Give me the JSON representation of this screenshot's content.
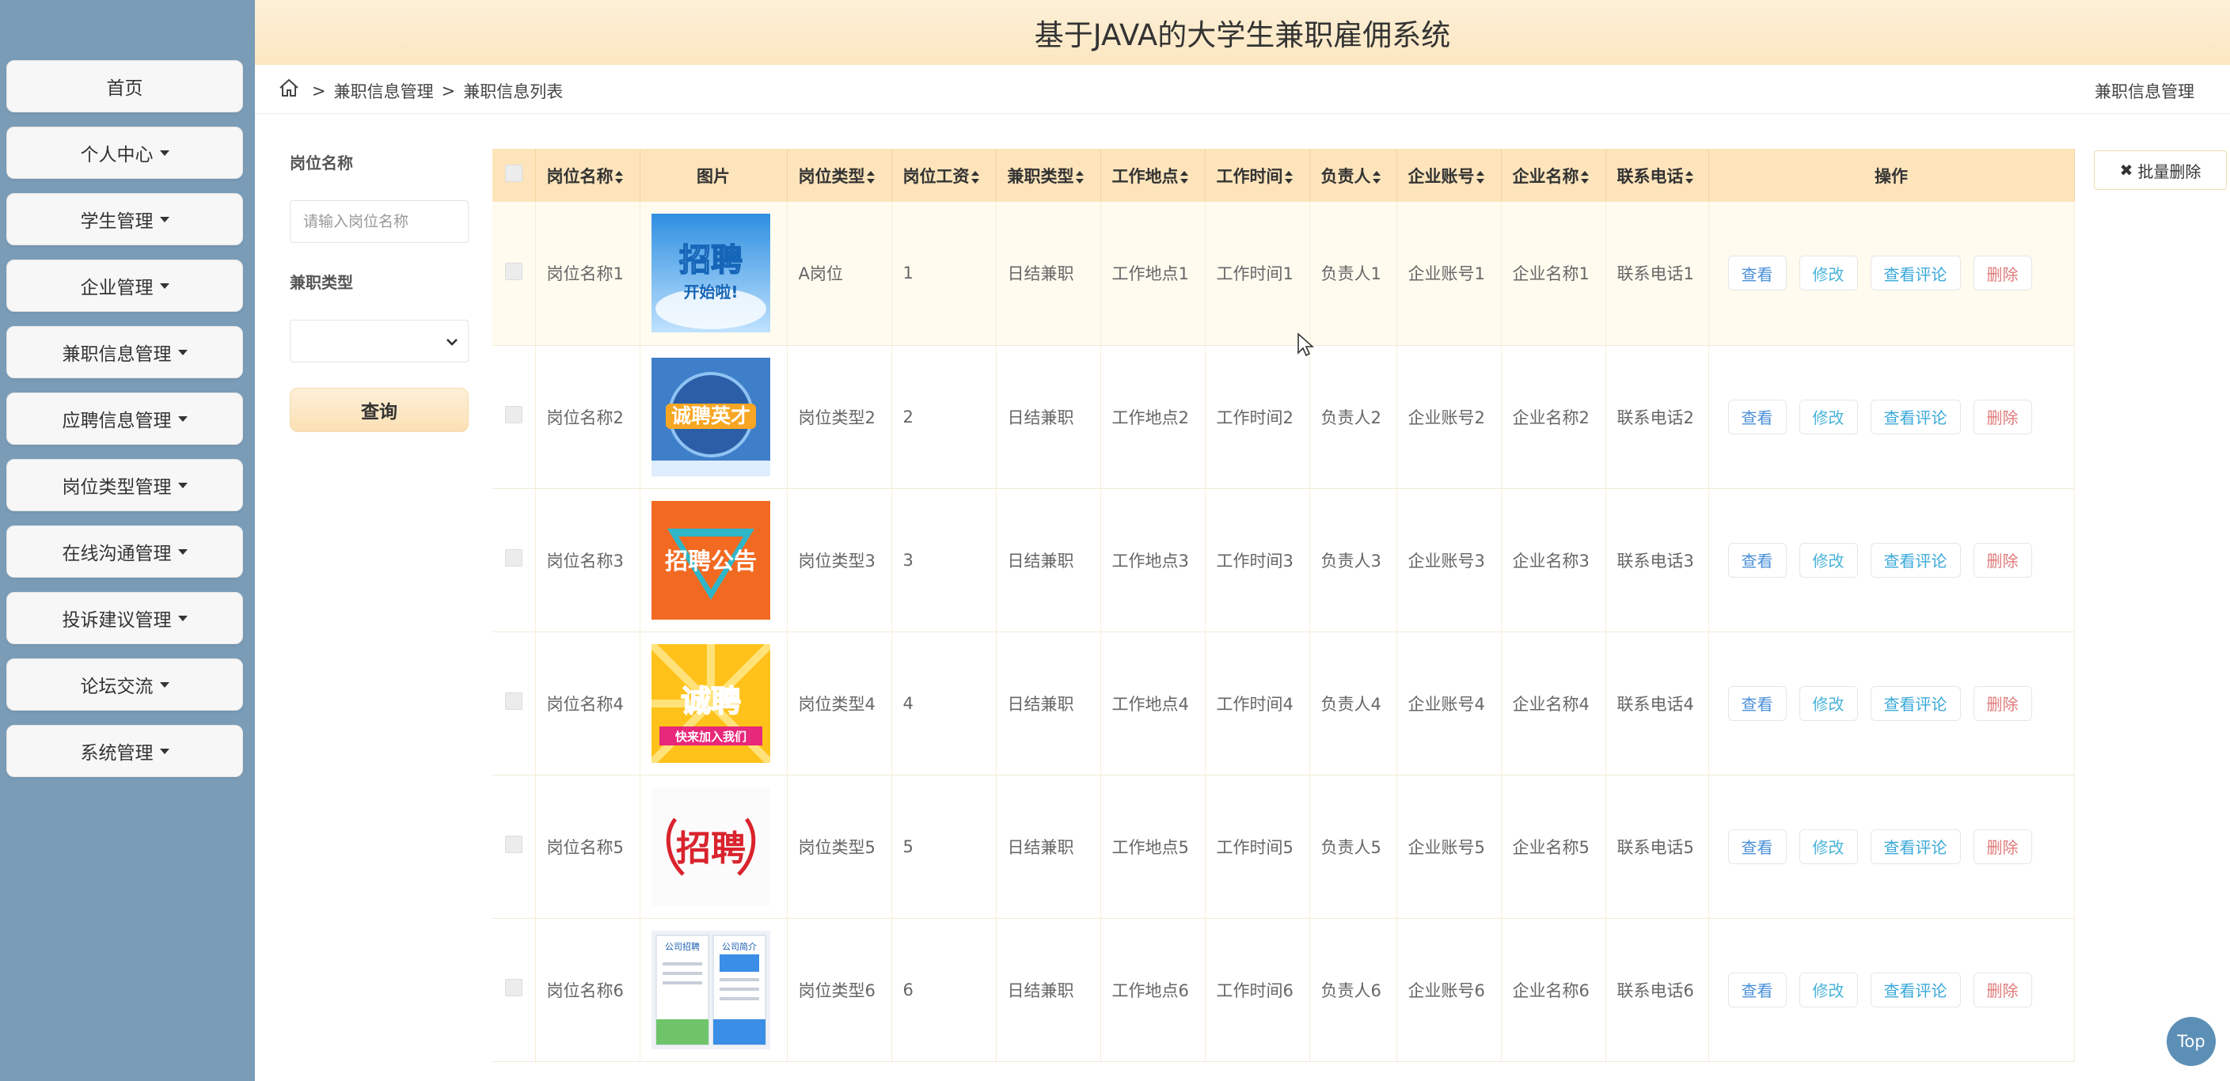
{
  "header": {
    "title": "基于JAVA的大学生兼职雇佣系统"
  },
  "sidebar": {
    "items": [
      {
        "label": "首页",
        "dropdown": false
      },
      {
        "label": "个人中心",
        "dropdown": true
      },
      {
        "label": "学生管理",
        "dropdown": true
      },
      {
        "label": "企业管理",
        "dropdown": true
      },
      {
        "label": "兼职信息管理",
        "dropdown": true
      },
      {
        "label": "应聘信息管理",
        "dropdown": true
      },
      {
        "label": "岗位类型管理",
        "dropdown": true
      },
      {
        "label": "在线沟通管理",
        "dropdown": true
      },
      {
        "label": "投诉建议管理",
        "dropdown": true
      },
      {
        "label": "论坛交流",
        "dropdown": true
      },
      {
        "label": "系统管理",
        "dropdown": true
      }
    ]
  },
  "breadcrumb": {
    "items": [
      "兼职信息管理",
      "兼职信息列表"
    ],
    "right": "兼职信息管理"
  },
  "search": {
    "name_label": "岗位名称",
    "name_placeholder": "请输入岗位名称",
    "type_label": "兼职类型",
    "type_value": "",
    "button": "查询"
  },
  "actions": {
    "batch_delete": "批量删除"
  },
  "table": {
    "columns": [
      "岗位名称",
      "图片",
      "岗位类型",
      "岗位工资",
      "兼职类型",
      "工作地点",
      "工作时间",
      "负责人",
      "企业账号",
      "企业名称",
      "联系电话",
      "操作"
    ],
    "rows": [
      {
        "name": "岗位名称1",
        "image": "poster-blue-sky",
        "type": "A岗位",
        "salary": "1",
        "ptype": "日结兼职",
        "place": "工作地点1",
        "time": "工作时间1",
        "manager": "负责人1",
        "account": "企业账号1",
        "company": "企业名称1",
        "phone": "联系电话1"
      },
      {
        "name": "岗位名称2",
        "image": "poster-globe",
        "type": "岗位类型2",
        "salary": "2",
        "ptype": "日结兼职",
        "place": "工作地点2",
        "time": "工作时间2",
        "manager": "负责人2",
        "account": "企业账号2",
        "company": "企业名称2",
        "phone": "联系电话2"
      },
      {
        "name": "岗位名称3",
        "image": "poster-orange",
        "type": "岗位类型3",
        "salary": "3",
        "ptype": "日结兼职",
        "place": "工作地点3",
        "time": "工作时间3",
        "manager": "负责人3",
        "account": "企业账号3",
        "company": "企业名称3",
        "phone": "联系电话3"
      },
      {
        "name": "岗位名称4",
        "image": "poster-sunburst",
        "type": "岗位类型4",
        "salary": "4",
        "ptype": "日结兼职",
        "place": "工作地点4",
        "time": "工作时间4",
        "manager": "负责人4",
        "account": "企业账号4",
        "company": "企业名称4",
        "phone": "联系电话4"
      },
      {
        "name": "岗位名称5",
        "image": "poster-red-calligraphy",
        "type": "岗位类型5",
        "salary": "5",
        "ptype": "日结兼职",
        "place": "工作地点5",
        "time": "工作时间5",
        "manager": "负责人5",
        "account": "企业账号5",
        "company": "企业名称5",
        "phone": "联系电话5"
      },
      {
        "name": "岗位名称6",
        "image": "poster-flyers",
        "type": "岗位类型6",
        "salary": "6",
        "ptype": "日结兼职",
        "place": "工作地点6",
        "time": "工作时间6",
        "manager": "负责人6",
        "account": "企业账号6",
        "company": "企业名称6",
        "phone": "联系电话6"
      }
    ],
    "ops": {
      "view": "查看",
      "edit": "修改",
      "comments": "查看评论",
      "delete": "删除"
    }
  },
  "poster_text": {
    "p1_a": "招聘",
    "p1_b": "开始啦!",
    "p2": "诚聘英才",
    "p3": "招聘公告",
    "p4_a": "诚聘",
    "p4_b": "快来加入我们",
    "p5": "招聘",
    "p6_a": "公司招聘",
    "p6_b": "公司简介"
  },
  "top_button": "Top",
  "colors": {
    "sidebar_bg": "#7a9cb7",
    "header_bg": "#fbe6c0",
    "table_header_bg": "#fde4bb",
    "accent_blue": "#5b8fb6",
    "delete_red": "#e07a7a"
  }
}
